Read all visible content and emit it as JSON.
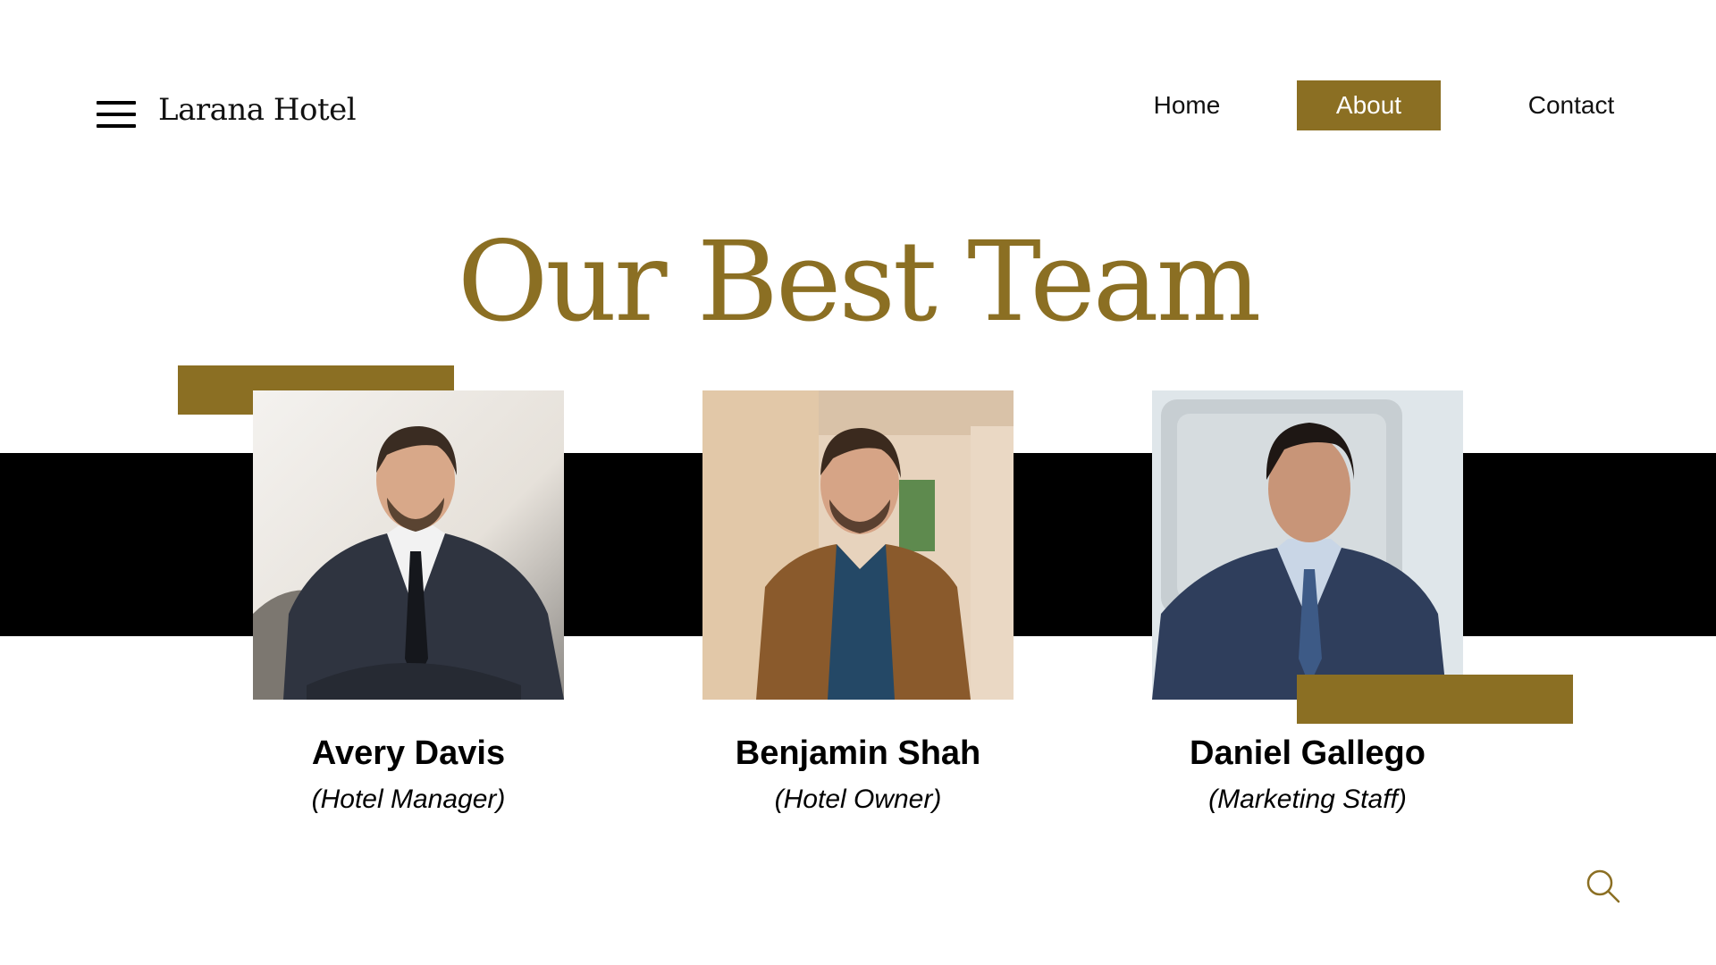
{
  "header": {
    "brand": "Larana Hotel",
    "nav": [
      {
        "label": "Home",
        "active": false
      },
      {
        "label": "About",
        "active": true
      },
      {
        "label": "Contact",
        "active": false
      }
    ]
  },
  "main": {
    "title": "Our Best Team",
    "team": [
      {
        "name": "Avery Davis",
        "role": "(Hotel Manager)"
      },
      {
        "name": "Benjamin Shah",
        "role": "(Hotel Owner)"
      },
      {
        "name": "Daniel Gallego",
        "role": "(Marketing Staff)"
      }
    ]
  },
  "icons": {
    "menu": "hamburger-menu-icon",
    "search": "search-icon"
  },
  "colors": {
    "accent": "#8b6f23",
    "band": "#000000",
    "background": "#ffffff"
  }
}
